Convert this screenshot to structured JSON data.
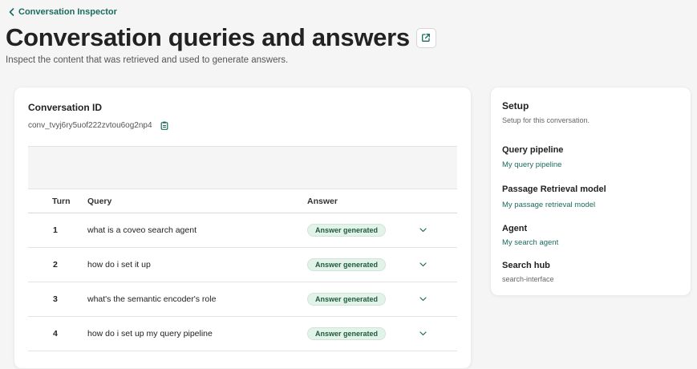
{
  "breadcrumb": {
    "label": "Conversation Inspector"
  },
  "header": {
    "title": "Conversation queries and answers",
    "subtitle": "Inspect the content that was retrieved and used to generate answers."
  },
  "conversation": {
    "id_label": "Conversation ID",
    "id_value": "conv_tvyj6ry5uof222zvtou6og2np4"
  },
  "table": {
    "headers": {
      "turn": "Turn",
      "query": "Query",
      "answer": "Answer"
    },
    "rows": [
      {
        "turn": "1",
        "query": "what is a coveo search agent",
        "answer": "Answer generated"
      },
      {
        "turn": "2",
        "query": "how do i set it up",
        "answer": "Answer generated"
      },
      {
        "turn": "3",
        "query": "what's the semantic encoder's role",
        "answer": "Answer generated"
      },
      {
        "turn": "4",
        "query": "how do i set up my query pipeline",
        "answer": "Answer generated"
      }
    ]
  },
  "setup": {
    "title": "Setup",
    "description": "Setup for this conversation.",
    "query_pipeline": {
      "label": "Query pipeline",
      "value": "My query pipeline"
    },
    "passage_retrieval_model": {
      "label": "Passage Retrieval model",
      "value": "My passage retrieval model"
    },
    "agent": {
      "label": "Agent",
      "value": "My search agent"
    },
    "search_hub": {
      "label": "Search hub",
      "value": "search-interface"
    }
  },
  "colors": {
    "accent": "#1b6b5e",
    "badge_bg": "#e3f3ea",
    "background": "#f5f5f5"
  },
  "icons": {
    "back": "chevron-left-icon",
    "external": "external-link-icon",
    "copy": "clipboard-icon",
    "expand": "chevron-down-icon"
  }
}
